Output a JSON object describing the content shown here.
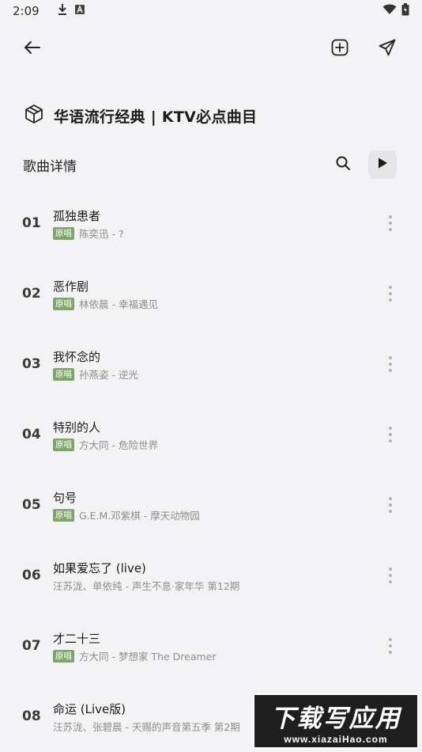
{
  "status_bar": {
    "time": "2:09"
  },
  "toolbar": {
    "back_icon": "arrow-left-icon",
    "add_icon": "plus-square-icon",
    "share_icon": "send-icon"
  },
  "playlist": {
    "icon": "cube-icon",
    "title": "华语流行经典 | KTV必点曲目"
  },
  "section": {
    "title": "歌曲详情"
  },
  "colors": {
    "background": "#f3f3f5",
    "tag_green": "#7fa56b",
    "meta_gray": "#8d8d8d"
  },
  "songs": [
    {
      "index": "01",
      "title": "孤独患者",
      "tag": "原唱",
      "meta": "陈奕迅 - ?"
    },
    {
      "index": "02",
      "title": "恶作剧",
      "tag": "原唱",
      "meta": "林依晨 - 幸福遇见"
    },
    {
      "index": "03",
      "title": "我怀念的",
      "tag": "原唱",
      "meta": "孙燕姿 - 逆光"
    },
    {
      "index": "04",
      "title": "特别的人",
      "tag": "原唱",
      "meta": "方大同 - 危险世界"
    },
    {
      "index": "05",
      "title": "句号",
      "tag": "原唱",
      "meta": "G.E.M.邓紫棋 - 摩天动物园"
    },
    {
      "index": "06",
      "title": "如果爱忘了 (live)",
      "tag": "",
      "meta": "汪苏泷、单依纯 - 声生不息·家年华 第12期"
    },
    {
      "index": "07",
      "title": "才二十三",
      "tag": "原唱",
      "meta": "方大同 - 梦想家 The Dreamer"
    },
    {
      "index": "08",
      "title": "命运 (Live版)",
      "tag": "",
      "meta": "汪苏泷、张碧晨 - 天赐的声音第五季 第2期"
    }
  ],
  "watermark": {
    "main": "下载写应用",
    "url": "www.xiazaiHao.com"
  }
}
